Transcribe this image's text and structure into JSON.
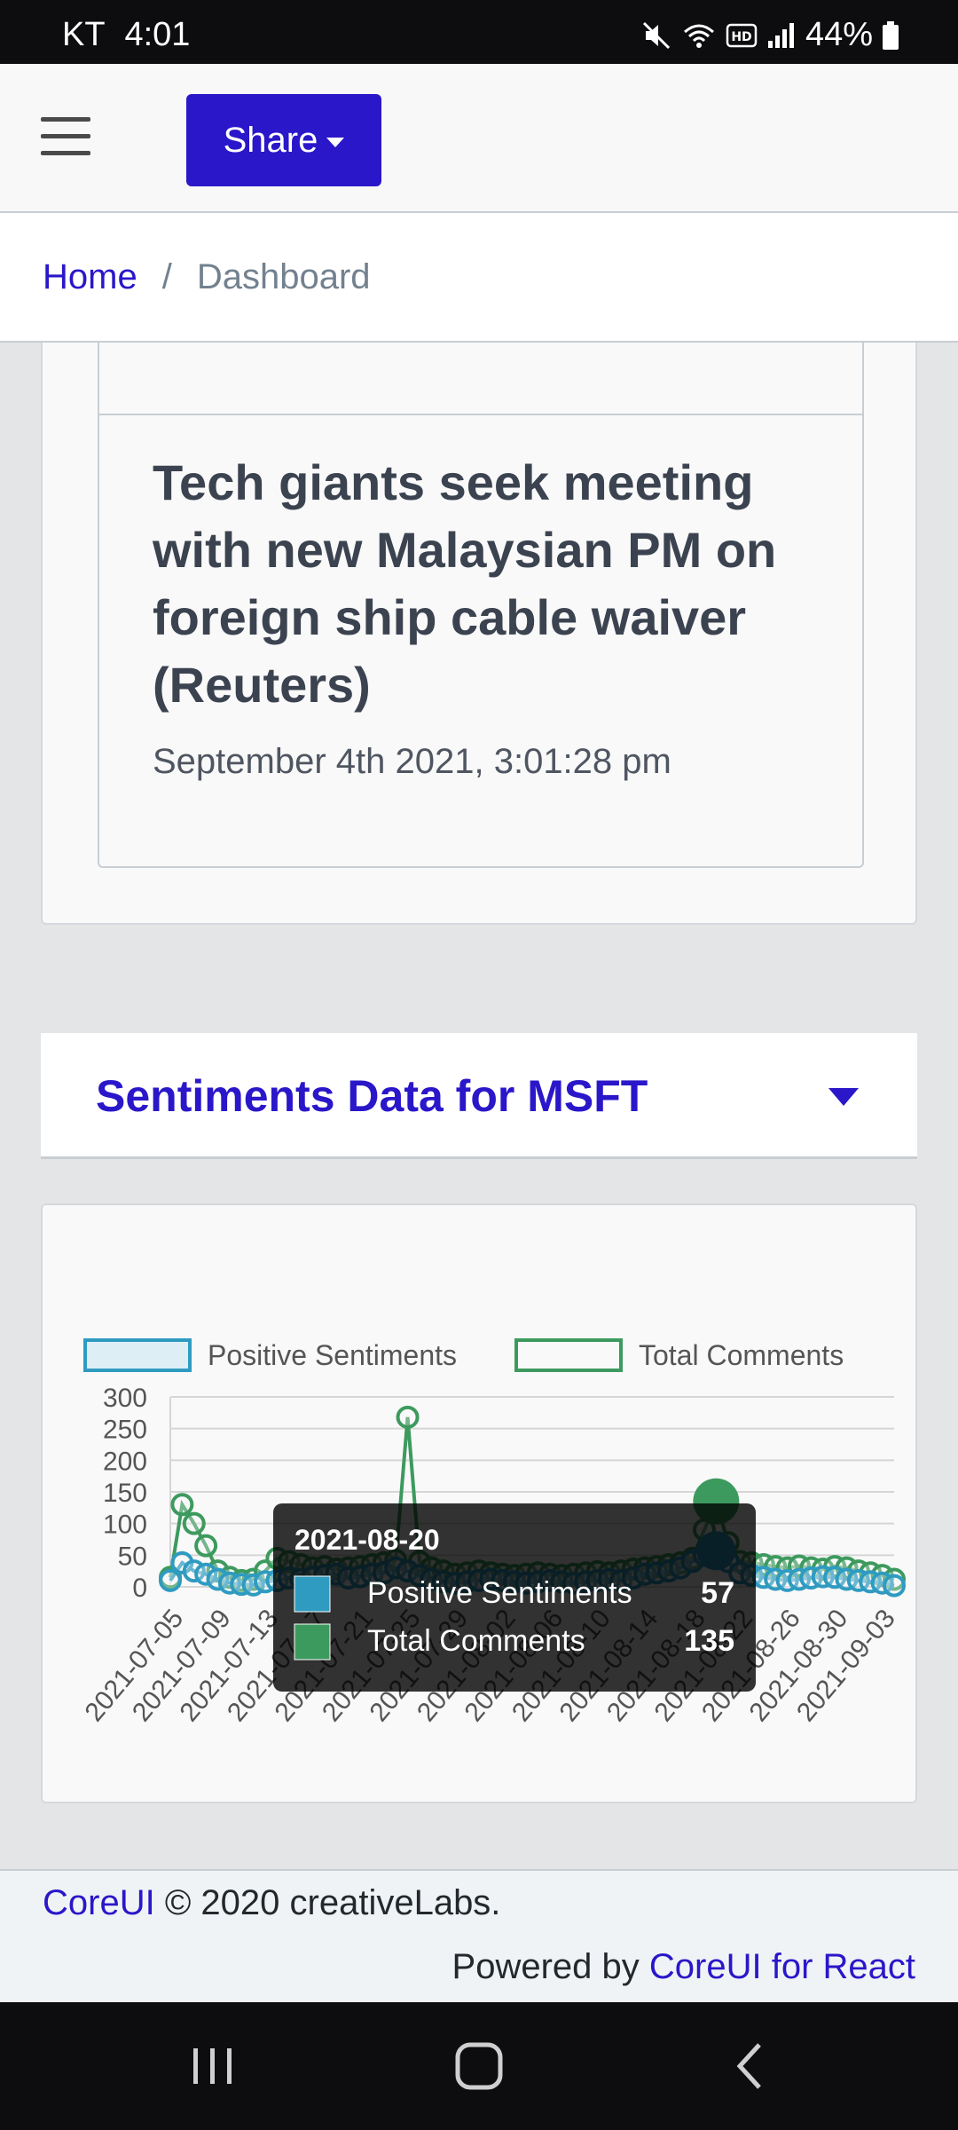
{
  "status_bar": {
    "carrier": "KT",
    "time": "4:01",
    "battery": "44%"
  },
  "header": {
    "share_label": "Share"
  },
  "breadcrumb": {
    "home": "Home",
    "separator": "/",
    "current": "Dashboard"
  },
  "news": {
    "title": "Tech giants seek meeting with new Malaysian PM on foreign ship cable waiver (Reuters)",
    "timestamp": "September 4th 2021, 3:01:28 pm"
  },
  "sentiments": {
    "title": "Sentiments Data for MSFT"
  },
  "chart_data": {
    "type": "line",
    "legend_position": "top",
    "grid": true,
    "ylim": [
      0,
      300
    ],
    "yticks": [
      0,
      50,
      100,
      150,
      200,
      250,
      300
    ],
    "x_tick_labels": [
      "2021-07-05",
      "2021-07-09",
      "2021-07-13",
      "2021-07-17",
      "2021-07-21",
      "2021-07-25",
      "2021-07-29",
      "2021-08-02",
      "2021-08-06",
      "2021-08-10",
      "2021-08-14",
      "2021-08-18",
      "2021-08-22",
      "2021-08-26",
      "2021-08-30",
      "2021-09-03"
    ],
    "series": [
      {
        "name": "Positive Sentiments",
        "color": "#2f9bc1",
        "values": [
          10,
          38,
          25,
          20,
          12,
          6,
          4,
          3,
          8,
          10,
          14,
          12,
          15,
          18,
          20,
          14,
          16,
          20,
          22,
          30,
          25,
          18,
          12,
          8,
          6,
          8,
          10,
          12,
          10,
          8,
          6,
          8,
          10,
          8,
          6,
          8,
          10,
          12,
          10,
          14,
          20,
          22,
          25,
          30,
          40,
          50,
          57,
          40,
          22,
          18,
          15,
          12,
          10,
          12,
          14,
          16,
          15,
          12,
          10,
          8,
          6,
          2
        ]
      },
      {
        "name": "Total Comments",
        "color": "#3d9a5e",
        "values": [
          15,
          130,
          100,
          65,
          25,
          15,
          10,
          12,
          25,
          45,
          40,
          35,
          30,
          32,
          28,
          30,
          32,
          35,
          38,
          42,
          268,
          40,
          30,
          25,
          20,
          22,
          25,
          22,
          20,
          18,
          20,
          22,
          20,
          18,
          20,
          22,
          24,
          22,
          25,
          28,
          30,
          32,
          35,
          38,
          45,
          90,
          135,
          70,
          40,
          38,
          35,
          32,
          30,
          33,
          30,
          28,
          32,
          30,
          25,
          22,
          18,
          12
        ]
      }
    ],
    "tooltip": {
      "date": "2021-08-20",
      "rows": [
        {
          "label": "Positive Sentiments",
          "value": "57",
          "color": "#2f9bc1"
        },
        {
          "label": "Total Comments",
          "value": "135",
          "color": "#3d9a5e"
        }
      ]
    }
  },
  "footer": {
    "brand": "CoreUI",
    "copyright": "© 2020 creativeLabs.",
    "powered_prefix": "Powered by",
    "powered_link": "CoreUI for React"
  }
}
